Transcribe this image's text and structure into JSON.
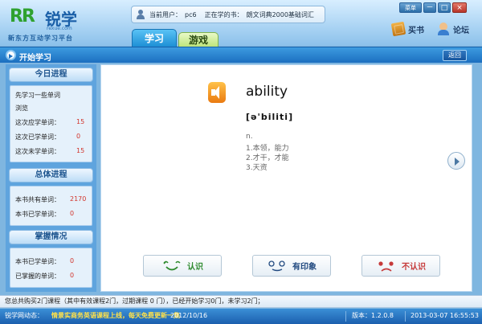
{
  "header": {
    "logo_mark": "RR",
    "logo_name": "锐学",
    "logo_url": "rexue.com",
    "logo_slogan": "新东方互动学习平台",
    "user_label": "当前用户：",
    "user_name": "pc6",
    "book_label": "正在学的书：",
    "book_name": "朗文词典2000基础词汇",
    "tabs": [
      {
        "label": "学习",
        "active": true
      },
      {
        "label": "游戏",
        "active": false
      }
    ],
    "menu_label": "菜单",
    "window_buttons": {
      "minimize": "－",
      "maximize": "□",
      "close": "×"
    },
    "links": {
      "buy_book": "买书",
      "forum": "论坛"
    }
  },
  "titlebar": {
    "title": "开始学习",
    "back_label": "返回"
  },
  "sidebar": {
    "today": {
      "heading": "今日进程",
      "intro": [
        "先学习一些单词",
        "浏览"
      ],
      "rows": [
        {
          "label": "这次应学单词：",
          "value": "15"
        },
        {
          "label": "这次已学单词：",
          "value": "0"
        },
        {
          "label": "这次未学单词：",
          "value": "15"
        }
      ]
    },
    "overall": {
      "heading": "总体进程",
      "rows": [
        {
          "label": "本书共有单词：",
          "value": "2170"
        },
        {
          "label": "本书已学单词：",
          "value": "0"
        }
      ]
    },
    "mastery": {
      "heading": "掌握情况",
      "rows": [
        {
          "label": "本书已学单词：",
          "value": "0"
        },
        {
          "label": "已掌握的单词：",
          "value": "0"
        }
      ]
    }
  },
  "card": {
    "word": "ability",
    "phonetic": "[ə'biliti]",
    "part_of_speech": "n.",
    "definitions": [
      "1.本领，能力",
      "2.才干，才能",
      "3.天资"
    ]
  },
  "rating": {
    "know": "认识",
    "some_impression": "有印象",
    "dont_know": "不认识"
  },
  "status": {
    "message": "您总共购买2门课程（其中有效课程2门，过期课程 0 门），已经开始学习0门，未学习2门；"
  },
  "bottom": {
    "news_label": "锐学网动态：",
    "news_text": "情景实商务英语课程上线，每天免费更新一集",
    "news_date": "2012/10/16",
    "version_label": "版本：",
    "version": "1.2.0.8",
    "datetime": "2013-03-07  16:55:53"
  },
  "colors": {
    "accent": "#1c6fc0",
    "number": "#d2352c",
    "know": "#2e8a2e",
    "dont_know": "#c63a3a"
  }
}
